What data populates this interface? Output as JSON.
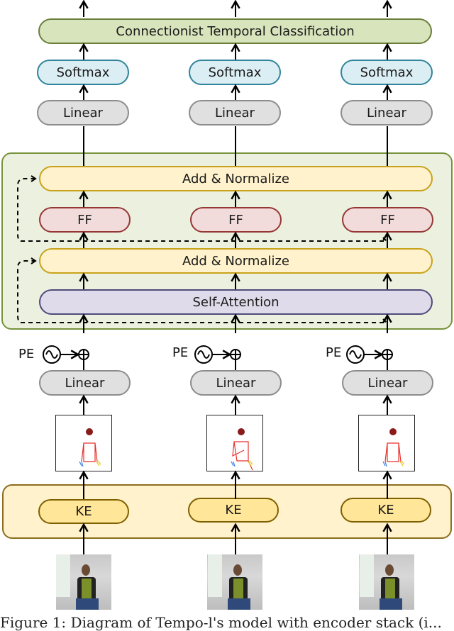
{
  "figure": {
    "columns": 3,
    "output_layer": {
      "label": "Connectionist Temporal Classification"
    },
    "softmax": {
      "label": "Softmax"
    },
    "linear_top": {
      "label": "Linear"
    },
    "encoder": {
      "add_normalize_top": {
        "label": "Add & Normalize"
      },
      "feed_forward": {
        "label": "FF"
      },
      "add_normalize_bottom": {
        "label": "Add & Normalize"
      },
      "self_attention": {
        "label": "Self-Attention"
      }
    },
    "positional_encoding": {
      "label": "PE",
      "icon": "sine-wave-icon",
      "combine_icon": "circle-plus-icon"
    },
    "linear_bottom": {
      "label": "Linear"
    },
    "keypoint_frames": {
      "description": "skeleton keypoint renderings"
    },
    "keypoint_extractor": {
      "label": "KE"
    },
    "input_frames": {
      "description": "video frames of signer"
    },
    "colors": {
      "ctc_fill": "#d8e4bc",
      "softmax_fill": "#dbeef4",
      "linear_fill": "#e0e0e0",
      "addnorm_fill": "#fff2cc",
      "ff_fill": "#f2dcdb",
      "selfatt_fill": "#e0dbea",
      "encoder_container": "#ebf1de",
      "ke_fill": "#ffe699",
      "ke_container": "#fff2cc"
    }
  },
  "caption": {
    "text": "Figure 1: Diagram of Tempo-l's model with encoder stack (i..."
  }
}
